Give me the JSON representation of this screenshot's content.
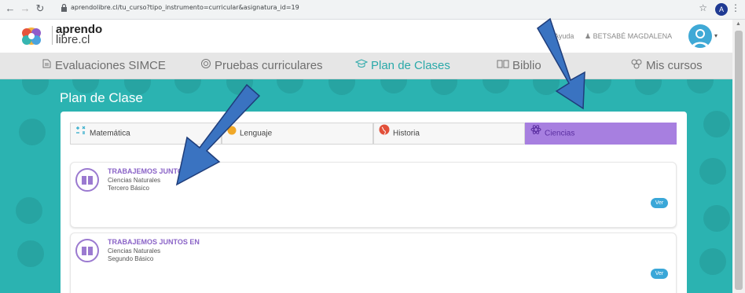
{
  "browser": {
    "url": "aprendolibre.cl/tu_curso?tipo_instrumento=curricular&asignatura_id=19",
    "profile_initial": "A"
  },
  "header": {
    "brand": "aprendo",
    "brand_sub": "libre.cl",
    "help_label": "Ayuda",
    "user_name": "BETSABÉ MAGDALENA"
  },
  "nav": {
    "items": [
      {
        "label": "Evaluaciones SIMCE",
        "icon": "document-icon"
      },
      {
        "label": "Pruebas curriculares",
        "icon": "target-icon"
      },
      {
        "label": "Plan de Clases",
        "icon": "graduation-cap-icon"
      },
      {
        "label": "Biblio",
        "icon": "book-icon"
      },
      {
        "label": "Mis cursos",
        "icon": "group-icon"
      }
    ],
    "active_index": 2
  },
  "main": {
    "title": "Plan de Clase",
    "tabs": [
      {
        "label": "Matemática",
        "icon": "math-operators-icon"
      },
      {
        "label": "Lenguaje",
        "icon": "book-icon"
      },
      {
        "label": "Historia",
        "icon": "globe-icon"
      },
      {
        "label": "Ciencias",
        "icon": "atom-icon"
      }
    ],
    "active_tab": 3,
    "cards": [
      {
        "title": "TRABAJEMOS JUNTOS",
        "subject": "Ciencias Naturales",
        "grade": "Tercero Básico",
        "button": "Ver"
      },
      {
        "title": "TRABAJEMOS JUNTOS EN",
        "subject": "Ciencias Naturales",
        "grade": "Segundo Básico",
        "button": "Ver"
      }
    ]
  },
  "colors": {
    "teal": "#2bb3b1",
    "purple_tab": "#a77fe0",
    "card_title": "#8a63c7",
    "ver_button": "#3aa7d8",
    "annotation_arrow": "#3a73c1"
  }
}
